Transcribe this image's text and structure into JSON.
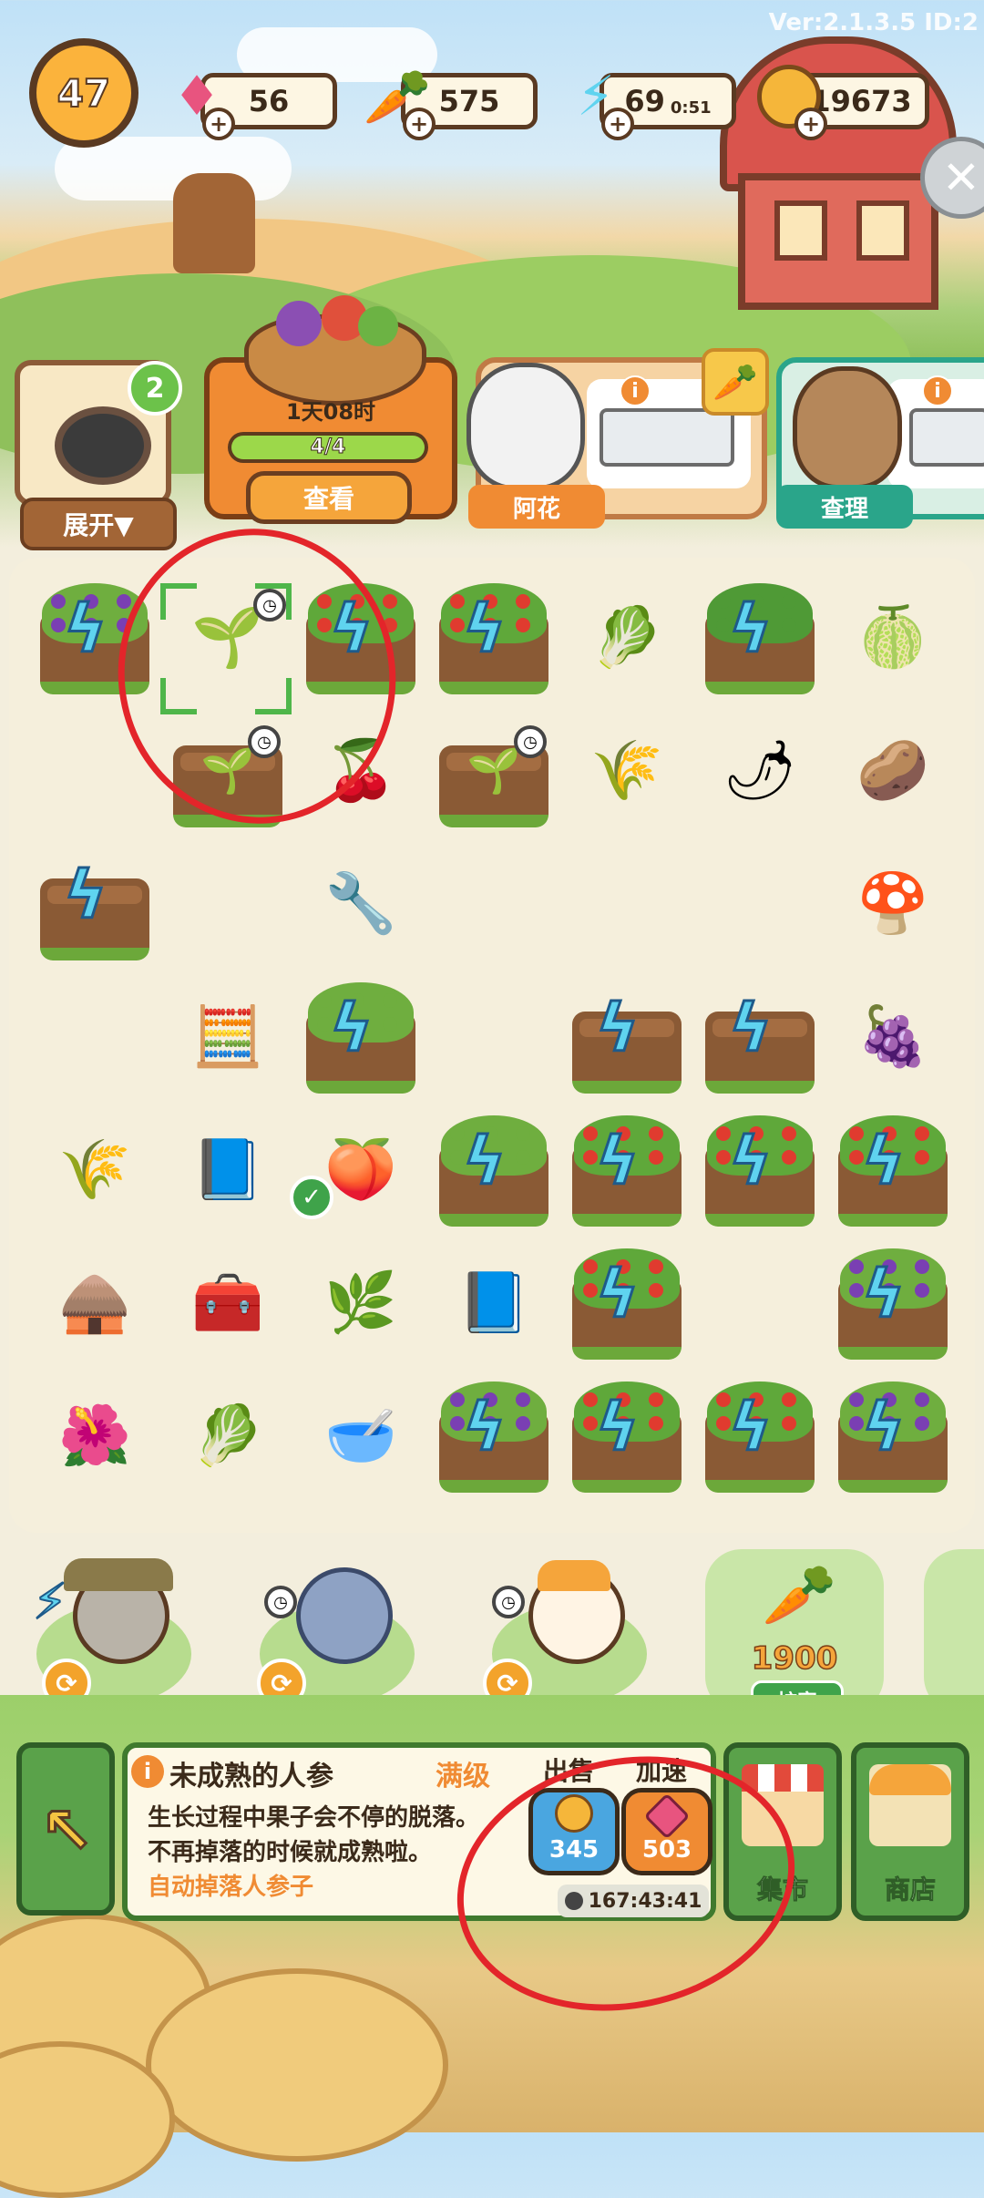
{
  "version": "Ver:2.1.3.5 ID:2",
  "top_bar": {
    "level": "47",
    "gems": "56",
    "carrots": "575",
    "energy": "69",
    "energy_timer": "0:51",
    "coins": "19673"
  },
  "orders": {
    "badge_count": "2",
    "expand_label": "展开▼",
    "main_order": {
      "time": "1天08时",
      "progress_label": "4/4",
      "progress": 1.0,
      "view_label": "查看"
    },
    "customers": [
      {
        "name": "阿花",
        "name_color": "#f08b33"
      },
      {
        "name": "查理",
        "name_color": "#2aa58a"
      }
    ]
  },
  "board": {
    "items": [
      {
        "name": "grape-vine-plot",
        "kind": "plot",
        "crop": "grape"
      },
      {
        "name": "ginseng-item",
        "kind": "item",
        "glyph": "🌱"
      },
      {
        "name": "tomato-plot",
        "kind": "plot",
        "crop": "tomato"
      },
      {
        "name": "tomato-plot",
        "kind": "plot",
        "crop": "tomato"
      },
      {
        "name": "cabbage-item",
        "kind": "item",
        "glyph": "🥬"
      },
      {
        "name": "berry-bush-plot",
        "kind": "plot",
        "crop": "bush"
      },
      {
        "name": "durian-item",
        "kind": "item",
        "glyph": "🍈"
      },
      {
        "name": "seedling-plot",
        "kind": "plot",
        "crop": "seed"
      },
      {
        "name": "goji-berry-item",
        "kind": "item",
        "glyph": "🍒"
      },
      {
        "name": "seedling-plot",
        "kind": "plot",
        "crop": "seed"
      },
      {
        "name": "wheat-stalk-item",
        "kind": "item",
        "glyph": "🌾"
      },
      {
        "name": "chili-pepper-item",
        "kind": "item",
        "glyph": "🌶"
      },
      {
        "name": "yellow-potato-item",
        "kind": "item",
        "glyph": "🥔"
      },
      {
        "name": "empty-plot",
        "kind": "plot",
        "crop": "empty"
      },
      {
        "name": "drill-tool-item",
        "kind": "item",
        "glyph": "🔧"
      },
      {
        "name": "fertilizer-bag-item",
        "kind": "item",
        "glyph": "🍄"
      },
      {
        "name": "calculator-item",
        "kind": "item",
        "glyph": "🧮"
      },
      {
        "name": "vine-plot",
        "kind": "plot",
        "crop": "vine"
      },
      {
        "name": "empty-plot",
        "kind": "plot",
        "crop": "empty"
      },
      {
        "name": "empty-plot",
        "kind": "plot",
        "crop": "empty"
      },
      {
        "name": "grape-sack-item",
        "kind": "item",
        "glyph": "🍇"
      },
      {
        "name": "seed-sack-item",
        "kind": "item",
        "glyph": "🌾"
      },
      {
        "name": "blueprint-item",
        "kind": "item",
        "glyph": "📘"
      },
      {
        "name": "passion-fruit-item",
        "kind": "item",
        "glyph": "🍑"
      },
      {
        "name": "vine-plot",
        "kind": "plot",
        "crop": "vine"
      },
      {
        "name": "tomato-bush-plot",
        "kind": "plot",
        "crop": "tomato"
      },
      {
        "name": "tomato-bush-plot",
        "kind": "plot",
        "crop": "tomato"
      },
      {
        "name": "tomato-bush-plot",
        "kind": "plot",
        "crop": "tomato"
      },
      {
        "name": "hay-hut-item",
        "kind": "item",
        "glyph": "🛖"
      },
      {
        "name": "toolbox-item",
        "kind": "item",
        "glyph": "🧰"
      },
      {
        "name": "parsley-item",
        "kind": "item",
        "glyph": "🌿"
      },
      {
        "name": "blueprint-item",
        "kind": "item",
        "glyph": "📘"
      },
      {
        "name": "tomato-bush-plot",
        "kind": "plot",
        "crop": "tomato"
      },
      {
        "name": "grape-vine-plot",
        "kind": "plot",
        "crop": "grape"
      },
      {
        "name": "red-flower-item",
        "kind": "item",
        "glyph": "🌺"
      },
      {
        "name": "leek-item",
        "kind": "item",
        "glyph": "🥬"
      },
      {
        "name": "flour-bowl-item",
        "kind": "item",
        "glyph": "🥣"
      },
      {
        "name": "grape-vine-plot",
        "kind": "plot",
        "crop": "grape"
      },
      {
        "name": "tomato-bush-plot",
        "kind": "plot",
        "crop": "tomato"
      },
      {
        "name": "tomato-bush-plot",
        "kind": "plot",
        "crop": "tomato"
      },
      {
        "name": "grape-vine-plot",
        "kind": "plot",
        "crop": "grape"
      }
    ]
  },
  "helpers": [
    {
      "name": "lynx-helper"
    },
    {
      "name": "koala-helper"
    },
    {
      "name": "rabbit-helper"
    }
  ],
  "expand_slot": {
    "price": "1900",
    "label": "扩容"
  },
  "info_panel": {
    "title": "未成熟的人参",
    "level": "满级",
    "desc_line1": "生长过程中果子会不停的脱落。",
    "desc_line2": "不再掉落的时候就成熟啦。",
    "desc_line3": "自动掉落人参子",
    "sell_label": "出售",
    "sell_value": "345",
    "speed_label": "加速",
    "speed_value": "503",
    "timer": "167:43:41"
  },
  "side_buttons": {
    "market": "集市",
    "shop": "商店"
  },
  "colors": {
    "accent": "#f08b33",
    "green": "#5aa24a",
    "annotation": "#e3252a"
  }
}
